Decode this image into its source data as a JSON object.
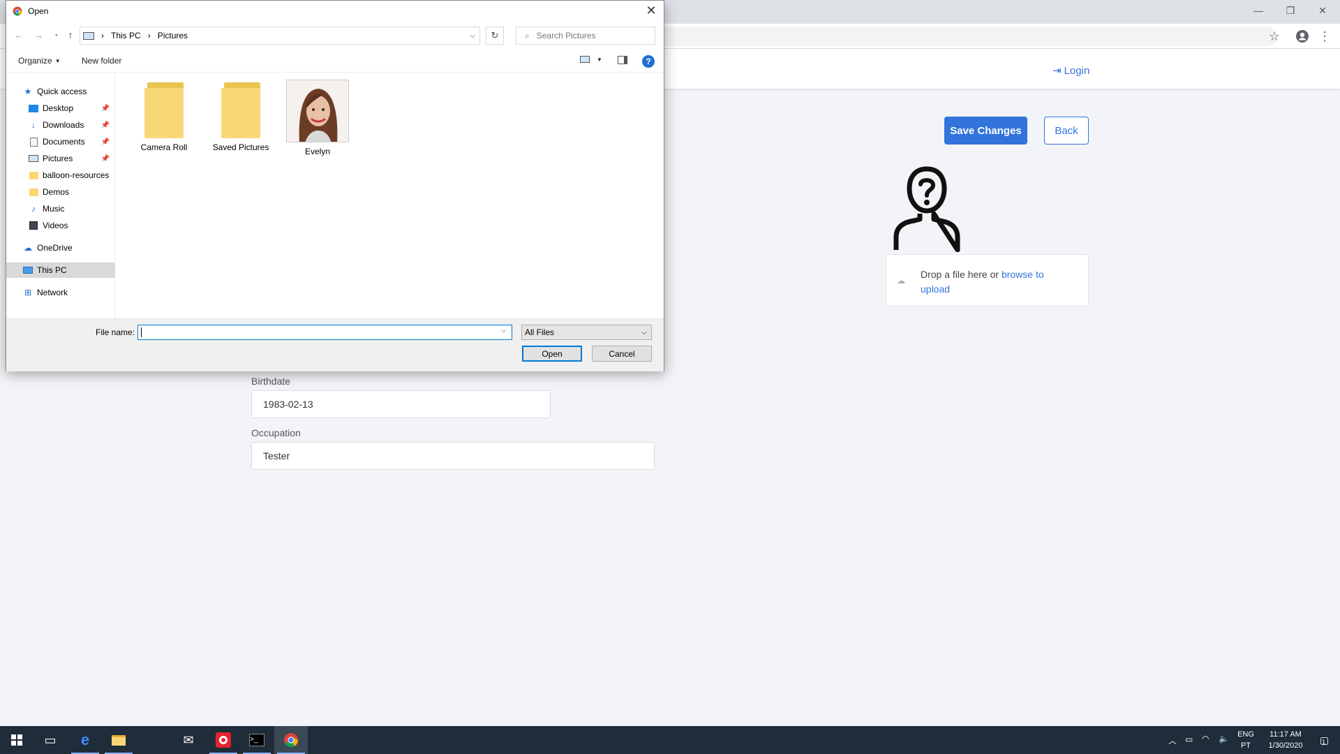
{
  "browser": {
    "minimize_glyph": "—",
    "restore_glyph": "❐",
    "close_glyph": "✕",
    "bookmark_icon": "star-icon",
    "profile_icon": "account-icon",
    "menu_icon": "more-vert-icon"
  },
  "app": {
    "nav": {
      "login_label": "Login"
    },
    "buttons": {
      "save_label": "Save Changes",
      "back_label": "Back"
    },
    "upload": {
      "prefix": "Drop a file here or",
      "link": "browse to upload"
    },
    "form": {
      "birthdate": {
        "label": "Birthdate",
        "value": "1983-02-13"
      },
      "occupation": {
        "label": "Occupation",
        "value": "Tester"
      }
    },
    "accent_color": "#3273dc"
  },
  "dialog": {
    "title": "Open",
    "address": {
      "segments": [
        "This PC",
        "Pictures"
      ]
    },
    "search_placeholder": "Search Pictures",
    "toolbar": {
      "organize": "Organize",
      "new_folder": "New folder",
      "help": "?"
    },
    "nav_pane": [
      {
        "label": "Quick access",
        "icon": "star-icon",
        "pinned": false
      },
      {
        "label": "Desktop",
        "icon": "desktop-icon",
        "pinned": true
      },
      {
        "label": "Downloads",
        "icon": "download-icon",
        "pinned": true
      },
      {
        "label": "Documents",
        "icon": "document-icon",
        "pinned": true
      },
      {
        "label": "Pictures",
        "icon": "pictures-icon",
        "pinned": true
      },
      {
        "label": "balloon-resources",
        "icon": "folder-icon",
        "pinned": false
      },
      {
        "label": "Demos",
        "icon": "folder-icon",
        "pinned": false
      },
      {
        "label": "Music",
        "icon": "music-icon",
        "pinned": false
      },
      {
        "label": "Videos",
        "icon": "video-icon",
        "pinned": false
      },
      {
        "label": "OneDrive",
        "icon": "cloud-icon",
        "pinned": false
      },
      {
        "label": "This PC",
        "icon": "computer-icon",
        "pinned": false,
        "selected": true
      },
      {
        "label": "Network",
        "icon": "network-icon",
        "pinned": false
      }
    ],
    "items": [
      {
        "label": "Camera Roll",
        "type": "folder"
      },
      {
        "label": "Saved Pictures",
        "type": "folder"
      },
      {
        "label": "Evelyn",
        "type": "image"
      }
    ],
    "file_name_label": "File name:",
    "file_name_value": "",
    "file_type": "All Files",
    "open_label": "Open",
    "cancel_label": "Cancel"
  },
  "taskbar": {
    "apps": [
      "windows-start-icon",
      "task-view-icon",
      "edge-icon",
      "file-explorer-icon",
      "mail-icon",
      "record-icon",
      "terminal-icon",
      "chrome-icon"
    ],
    "language": [
      "ENG",
      "PT"
    ],
    "time": "11:17 AM",
    "date": "1/30/2020",
    "notification_count": "1"
  }
}
